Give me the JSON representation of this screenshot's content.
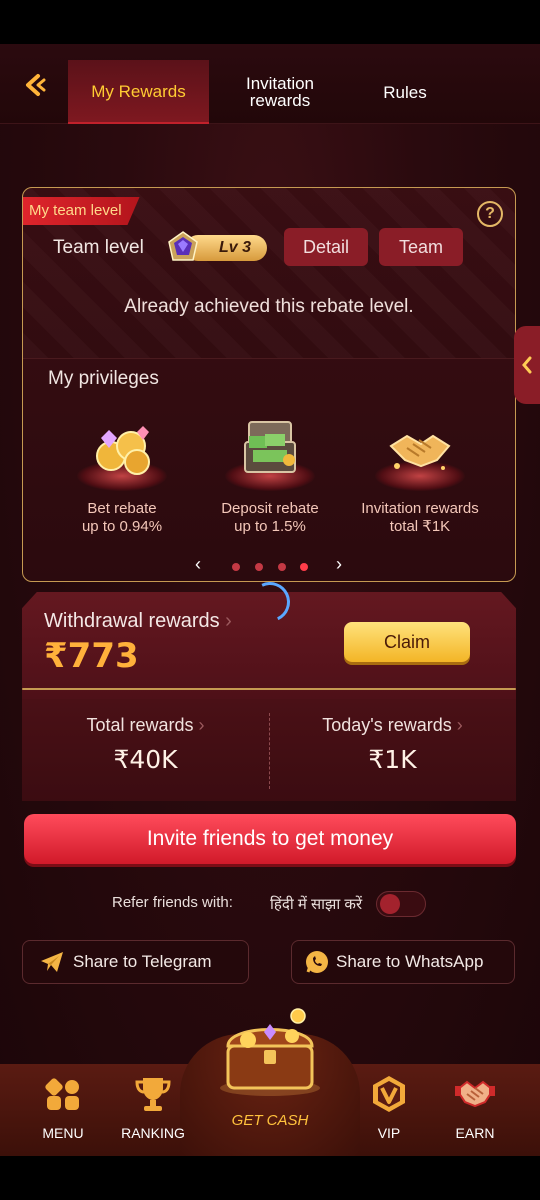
{
  "header": {
    "tabs": [
      {
        "label": "My Rewards",
        "active": true
      },
      {
        "label": "Invitation rewards",
        "active": false
      },
      {
        "label": "Rules",
        "active": false
      }
    ],
    "accent_color": "#ffcc33"
  },
  "team": {
    "ribbon_label": "My team level",
    "help_glyph": "?",
    "team_level_label": "Team level",
    "level_badge": "Lv 3",
    "detail_button": "Detail",
    "team_button": "Team",
    "status_text": "Already achieved this rebate level.",
    "privileges_title": "My privileges",
    "privileges": [
      {
        "line1": "Bet rebate",
        "line2": "up to 0.94%",
        "icon": "coins-gems-icon"
      },
      {
        "line1": "Deposit rebate",
        "line2": "up to 1.5%",
        "icon": "cash-chest-icon"
      },
      {
        "line1": "Invitation rewards",
        "line2": "total ₹1K",
        "icon": "handshake-icon"
      }
    ],
    "pager": {
      "total": 4,
      "active_index": 3
    }
  },
  "withdrawal": {
    "label": "Withdrawal rewards",
    "amount": "₹773",
    "claim_button": "Claim"
  },
  "totals": {
    "total_label": "Total rewards",
    "total_value": "₹40K",
    "today_label": "Today's rewards",
    "today_value": "₹1K"
  },
  "invite_button": "Invite friends to get money",
  "refer": {
    "label": "Refer friends with:",
    "language_text": "हिंदी में साझा करें",
    "toggle_on": false
  },
  "share": {
    "telegram": "Share to Telegram",
    "whatsapp": "Share to WhatsApp"
  },
  "nav": {
    "menu": "MENU",
    "ranking": "RANKING",
    "get_cash": "GET CASH",
    "vip": "VIP",
    "earn": "EARN"
  }
}
